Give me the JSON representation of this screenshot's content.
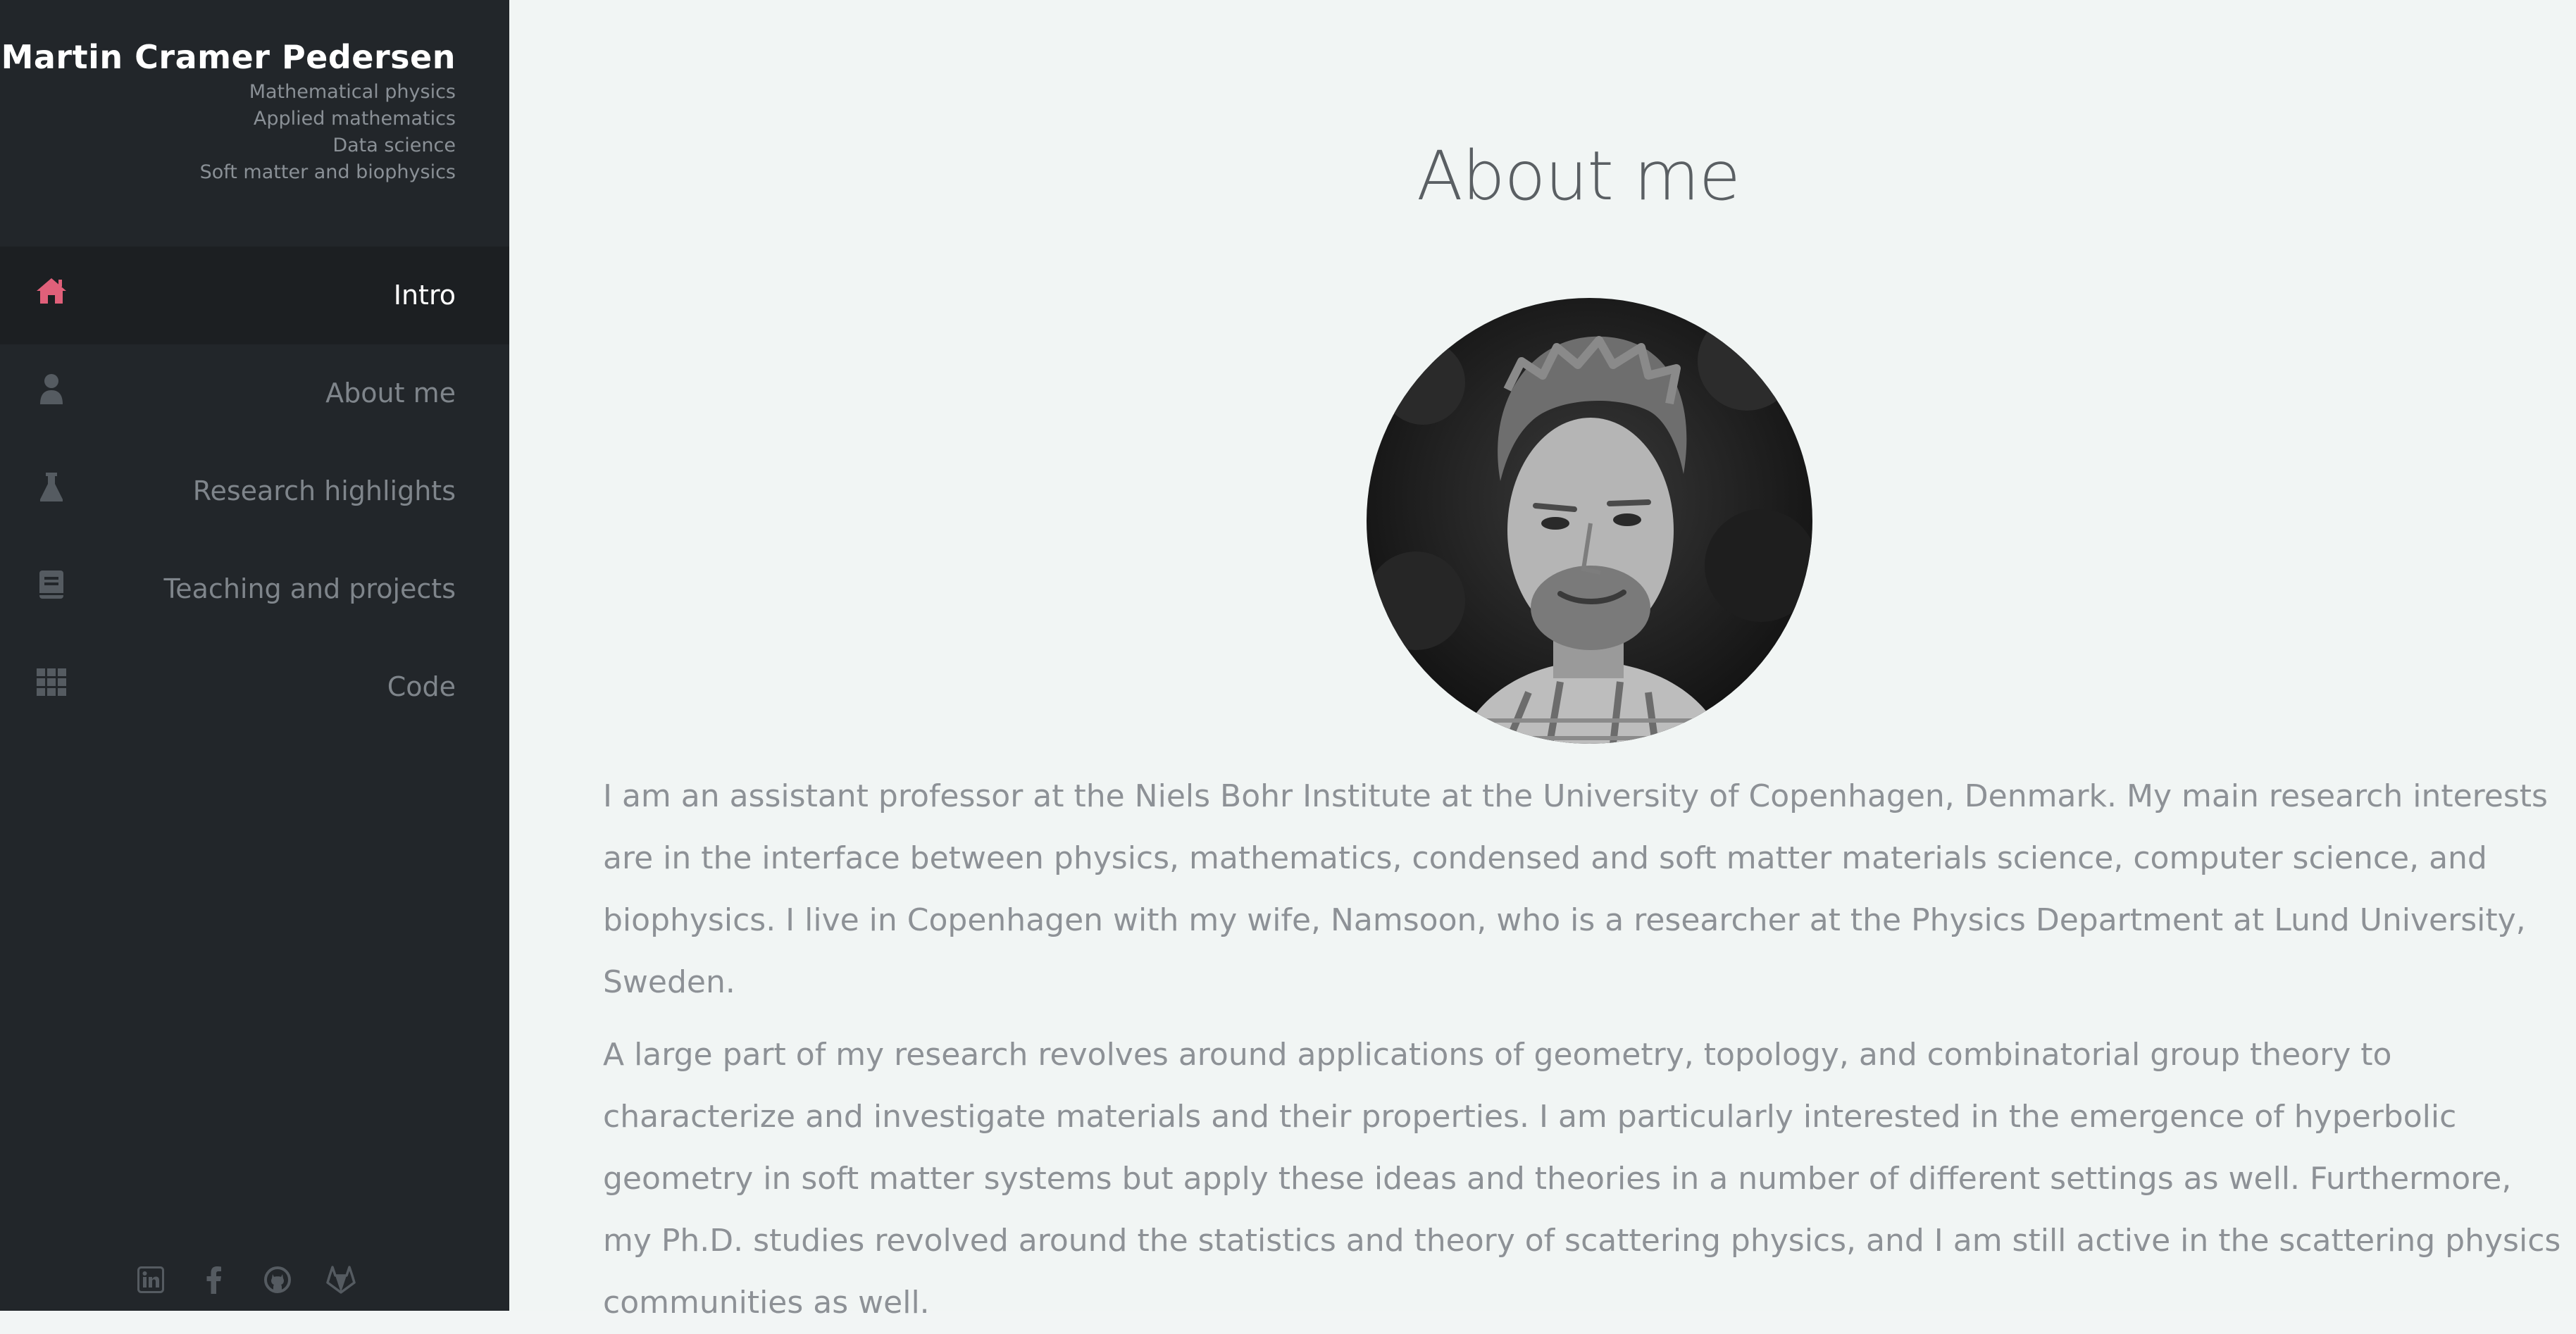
{
  "sidebar": {
    "name": "Martin Cramer Pedersen",
    "subtitles": [
      "Mathematical physics",
      "Applied mathematics",
      "Data science",
      "Soft matter and biophysics"
    ],
    "nav": [
      {
        "label": "Intro",
        "icon": "home-icon",
        "active": true
      },
      {
        "label": "About me",
        "icon": "user-icon",
        "active": false
      },
      {
        "label": "Research highlights",
        "icon": "flask-icon",
        "active": false
      },
      {
        "label": "Teaching and projects",
        "icon": "book-icon",
        "active": false
      },
      {
        "label": "Code",
        "icon": "grid-icon",
        "active": false
      }
    ],
    "socials": [
      "linkedin-icon",
      "facebook-icon",
      "github-icon",
      "gitlab-icon"
    ]
  },
  "main": {
    "title": "About me",
    "paragraphs": [
      "I am an assistant professor at the Niels Bohr Institute at the University of Copenhagen, Denmark. My main research interests are in the interface between physics, mathematics, condensed and soft matter materials science, computer science, and biophysics. I live in Copenhagen with my wife, Namsoon, who is a researcher at the Physics Department at Lund University, Sweden.",
      "A large part of my research revolves around applications of geometry, topology, and combinatorial group theory to characterize and investigate materials and their properties. I am particularly interested in the emergence of hyperbolic geometry in soft matter systems but apply these ideas and theories in a number of different settings as well. Furthermore, my Ph.D. studies revolved around the statistics and theory of scattering physics, and I am still active in the scattering physics communities as well."
    ]
  },
  "colors": {
    "sidebar_bg": "#22262a",
    "active_item_bg": "#1c1f22",
    "accent": "#e0607a",
    "main_bg": "#f1f5f4"
  }
}
